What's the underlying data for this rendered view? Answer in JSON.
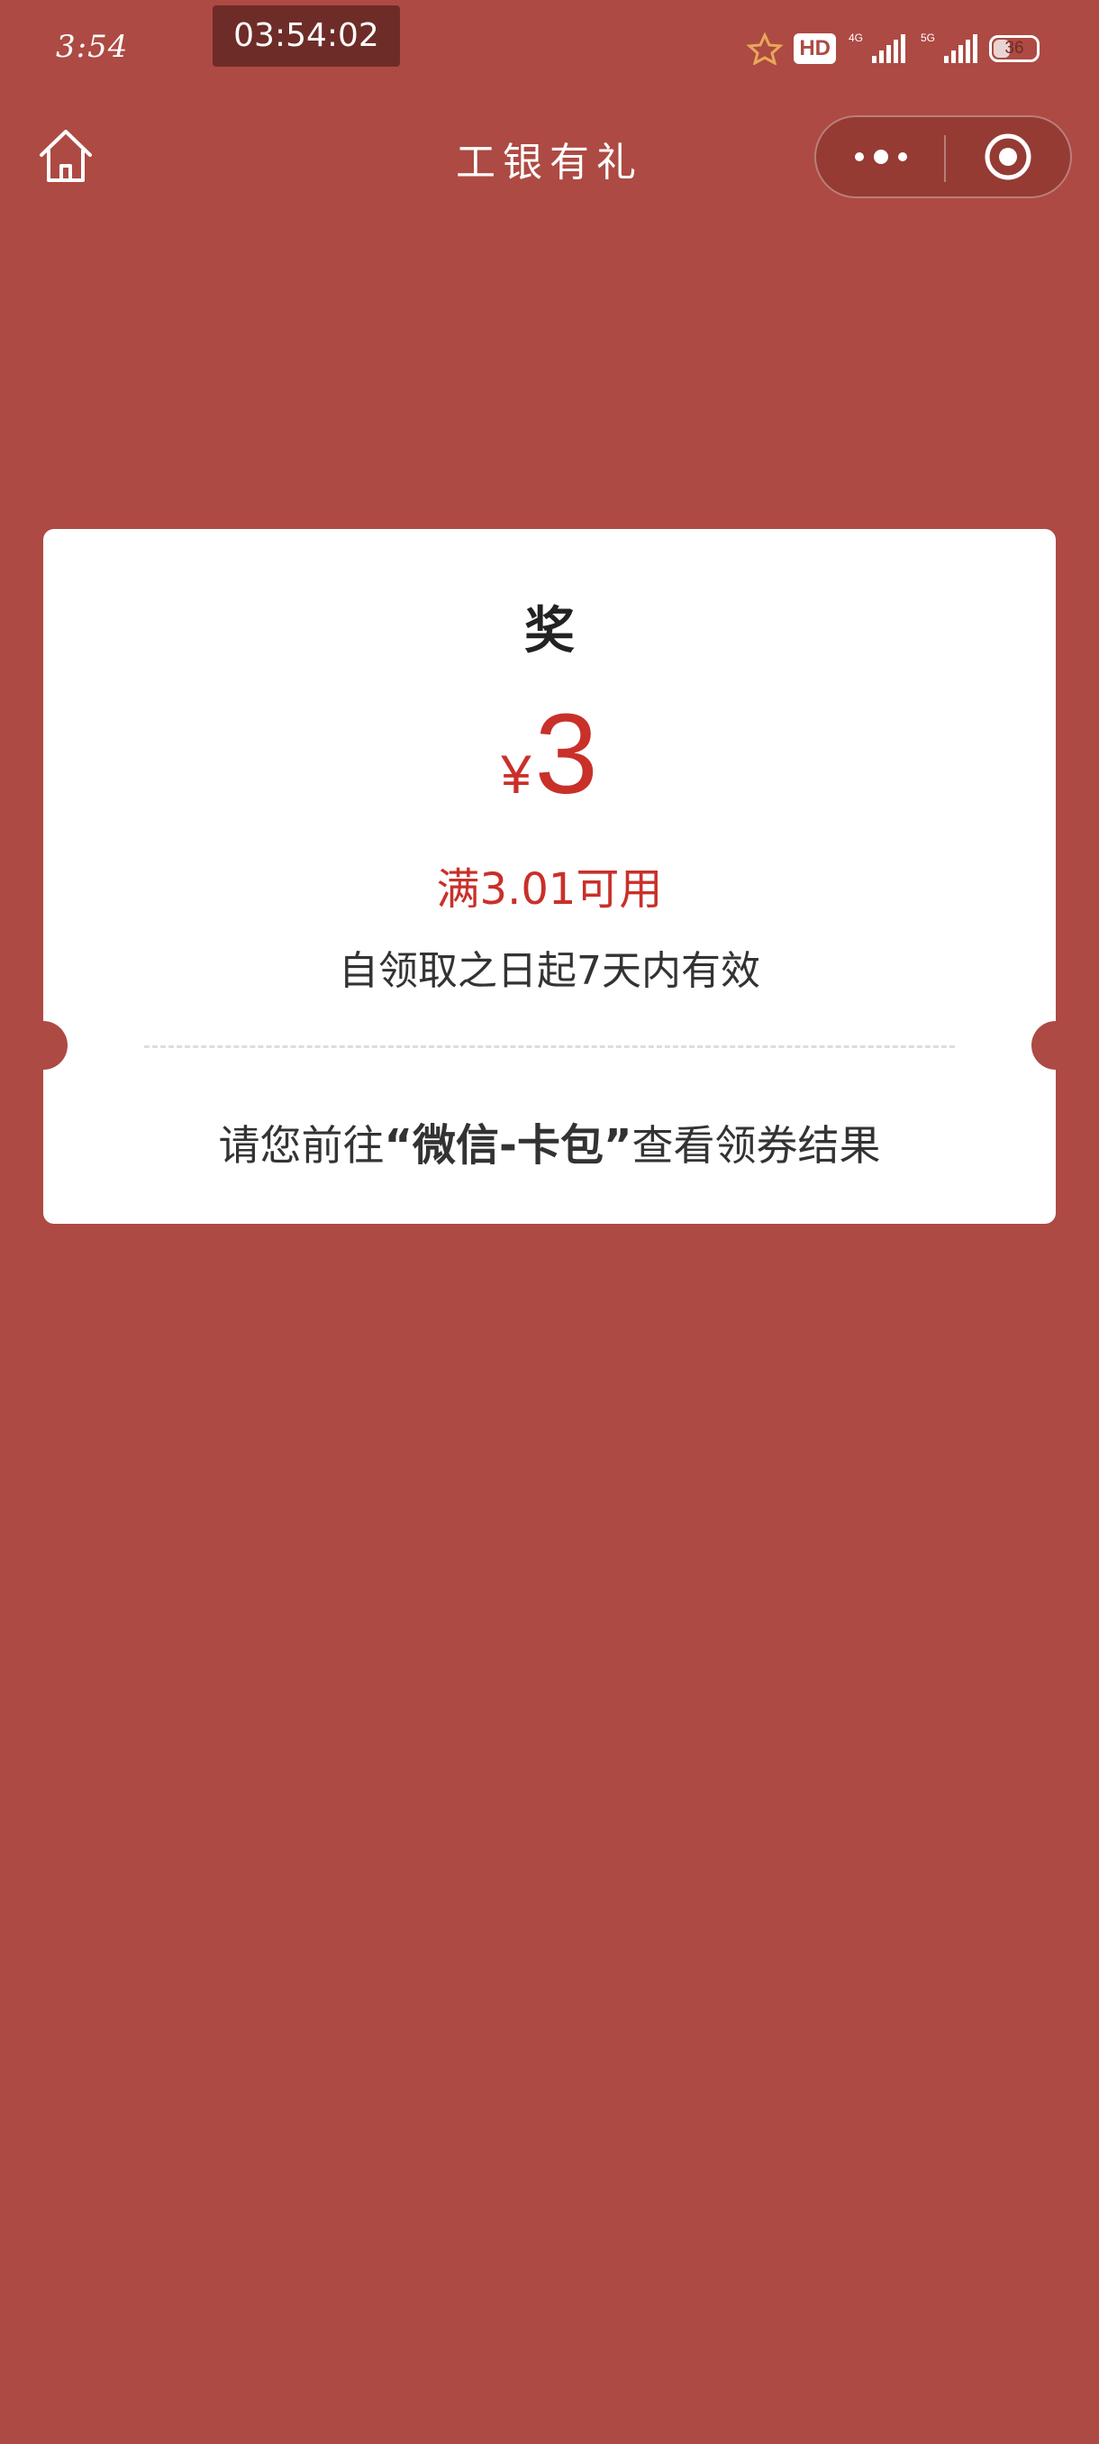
{
  "status_bar": {
    "time": "3:54",
    "recorder_time": "03:54:02",
    "hd_badge": "HD",
    "network_4g": "4G",
    "network_5g": "5G",
    "battery": "36"
  },
  "nav": {
    "title": "工银有礼"
  },
  "card": {
    "title": "奖",
    "currency_symbol": "¥",
    "amount": "3",
    "condition": "满3.01可用",
    "validity": "自领取之日起7天内有效",
    "instruction_prefix": "请您前往",
    "instruction_link": "“微信-卡包”",
    "instruction_suffix": "查看领券结果"
  },
  "colors": {
    "background": "#ad4a43",
    "accent_red": "#c9302a",
    "card": "#ffffff"
  }
}
